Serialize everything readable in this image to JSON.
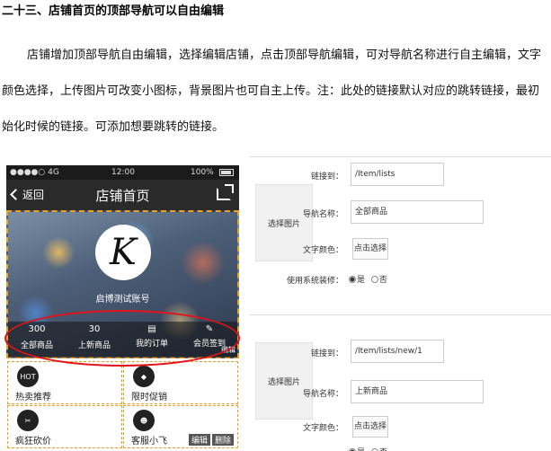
{
  "doc": {
    "title": "二十三、店铺首页的顶部导航可以自由编辑",
    "paragraph": "店铺增加顶部导航自由编辑，选择编辑店铺，点击顶部导航编辑，可对导航名称进行自主编辑，文字颜色选择，上传图片可改变小图标，背景图片也可自主上传。注：此处的链接默认对应的跳转链接，最初始化时候的链接。可添加想要跳转的链接。"
  },
  "phone": {
    "status": {
      "carrier": "●●●●○ 4G",
      "time": "12:00",
      "battery": "100%"
    },
    "nav": {
      "back": "返回",
      "title": "店铺首页"
    },
    "shop_name": "启博测试账号",
    "avatar_letter": "K",
    "stats": [
      {
        "value": "300",
        "label": "全部商品"
      },
      {
        "value": "30",
        "label": "上新商品"
      },
      {
        "value": "",
        "label": "我的订单"
      },
      {
        "value": "",
        "label": "会员签到"
      }
    ],
    "edit_badge": "编辑",
    "grid": [
      {
        "label": "热卖推荐",
        "icon": "hot-icon",
        "icon_text": "HOT"
      },
      {
        "label": "限时促销",
        "icon": "tag-icon",
        "icon_text": ""
      },
      {
        "label": "疯狂砍价",
        "icon": "cut-icon",
        "icon_text": ""
      },
      {
        "label": "客服小飞",
        "icon": "service-icon",
        "icon_text": ""
      }
    ],
    "actions": {
      "edit": "编辑",
      "delete": "删除"
    }
  },
  "panels": [
    {
      "image_label": "选择图片",
      "link_label": "链接到：",
      "link_value": "/Item/lists",
      "name_label": "导航名称：",
      "name_value": "全部商品",
      "color_label": "文字颜色：",
      "color_button": "点击选择",
      "style_label": "使用系统装修：",
      "yes": "是",
      "no": "否"
    },
    {
      "image_label": "选择图片",
      "link_label": "链接到：",
      "link_value": "/Item/lists/new/1",
      "name_label": "导航名称：",
      "name_value": "上新商品",
      "color_label": "文字颜色：",
      "color_button": "点击选择",
      "yes": "是",
      "no": "否"
    }
  ],
  "colors": {
    "highlight": "#e2131a",
    "dashed": "#f0a020",
    "nav_bg": "#2a2a2a"
  }
}
